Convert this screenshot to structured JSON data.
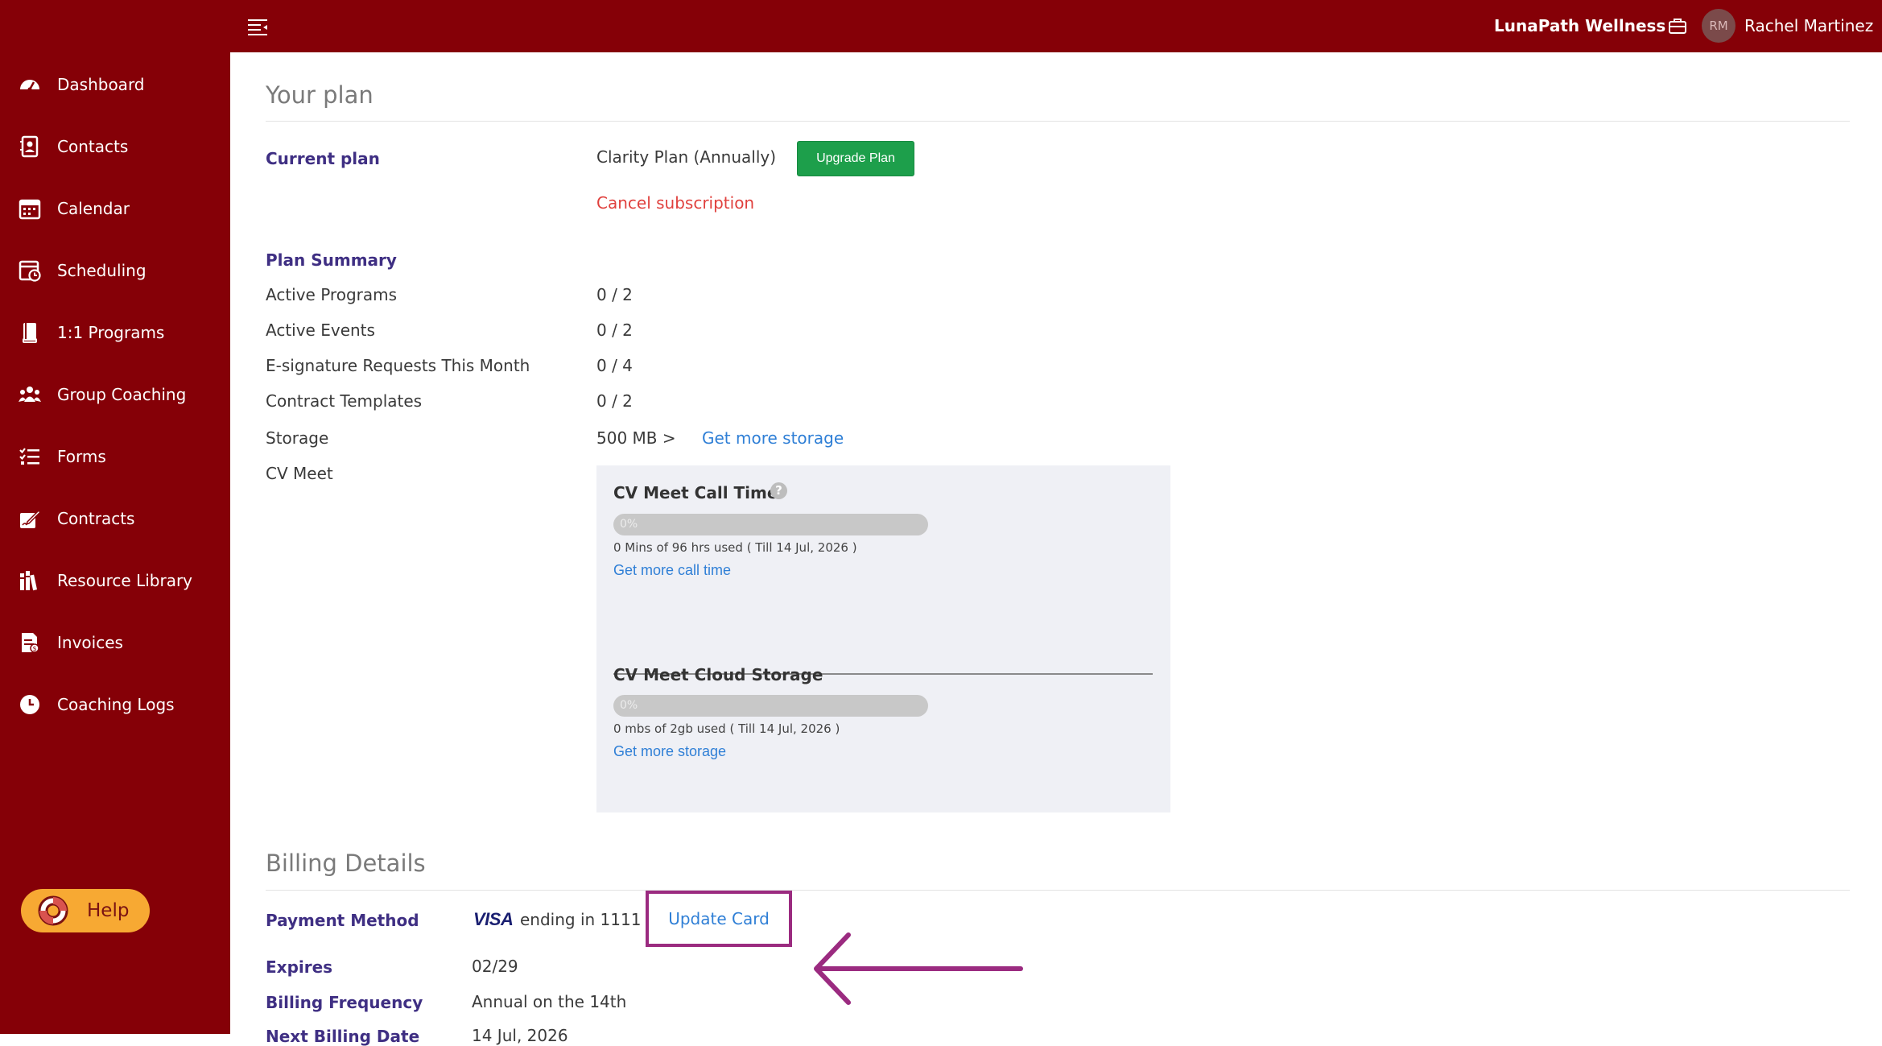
{
  "header": {
    "brand": "LunaPath Wellness",
    "avatar_initials": "RM",
    "user_name": "Rachel Martinez"
  },
  "sidebar": {
    "items": [
      {
        "label": "Dashboard",
        "icon": "dashboard-gauge-icon"
      },
      {
        "label": "Contacts",
        "icon": "contacts-book-icon"
      },
      {
        "label": "Calendar",
        "icon": "calendar-icon"
      },
      {
        "label": "Scheduling",
        "icon": "scheduling-calendar-clock-icon"
      },
      {
        "label": "1:1 Programs",
        "icon": "book-icon"
      },
      {
        "label": "Group Coaching",
        "icon": "users-group-icon"
      },
      {
        "label": "Forms",
        "icon": "checklist-icon"
      },
      {
        "label": "Contracts",
        "icon": "signature-pen-icon"
      },
      {
        "label": "Resource Library",
        "icon": "library-books-icon"
      },
      {
        "label": "Invoices",
        "icon": "invoice-icon"
      },
      {
        "label": "Coaching Logs",
        "icon": "clock-icon"
      }
    ],
    "help_label": "Help"
  },
  "plan": {
    "section_title": "Your plan",
    "current_plan_label": "Current plan",
    "current_plan_value": "Clarity Plan (Annually)",
    "upgrade_label": "Upgrade Plan",
    "cancel_label": "Cancel subscription",
    "summary_label": "Plan Summary",
    "rows": [
      {
        "label": "Active Programs",
        "value": "0 / 2"
      },
      {
        "label": "Active Events",
        "value": "0 / 2"
      },
      {
        "label": "E-signature Requests This Month",
        "value": "0 / 4"
      },
      {
        "label": "Contract Templates",
        "value": "0 / 2"
      }
    ],
    "storage_label": "Storage",
    "storage_value": "500 MB >",
    "storage_link": "Get more storage",
    "cv_meet_label": "CV Meet"
  },
  "cv_meet": {
    "call_time": {
      "title": "CV Meet Call Time",
      "help_glyph": "?",
      "progress": 0,
      "progress_text": "0%",
      "usage": "0 Mins of 96 hrs used ( Till 14 Jul, 2026 )",
      "link": "Get more call time"
    },
    "cloud_storage": {
      "title": "CV Meet Cloud Storage",
      "progress": 0,
      "progress_text": "0%",
      "usage": "0 mbs of 2gb used ( Till 14 Jul, 2026 )",
      "link": "Get more storage"
    }
  },
  "billing": {
    "section_title": "Billing Details",
    "payment_label": "Payment Method",
    "card_brand": "VISA",
    "card_ending": "ending in 1111",
    "update_label": "Update Card",
    "expires_label": "Expires",
    "expires_value": "02/29",
    "frequency_label": "Billing Frequency",
    "frequency_value": "Annual on the 14th",
    "next_label": "Next Billing Date",
    "next_value": "14 Jul, 2026"
  },
  "colors": {
    "brand": "#850007",
    "accent_link": "#2f7fd6",
    "label_purple": "#3f2f83",
    "success": "#1d9f4b",
    "danger": "#e0413e",
    "callout": "#9b2b80",
    "help_button": "#f7a933"
  }
}
